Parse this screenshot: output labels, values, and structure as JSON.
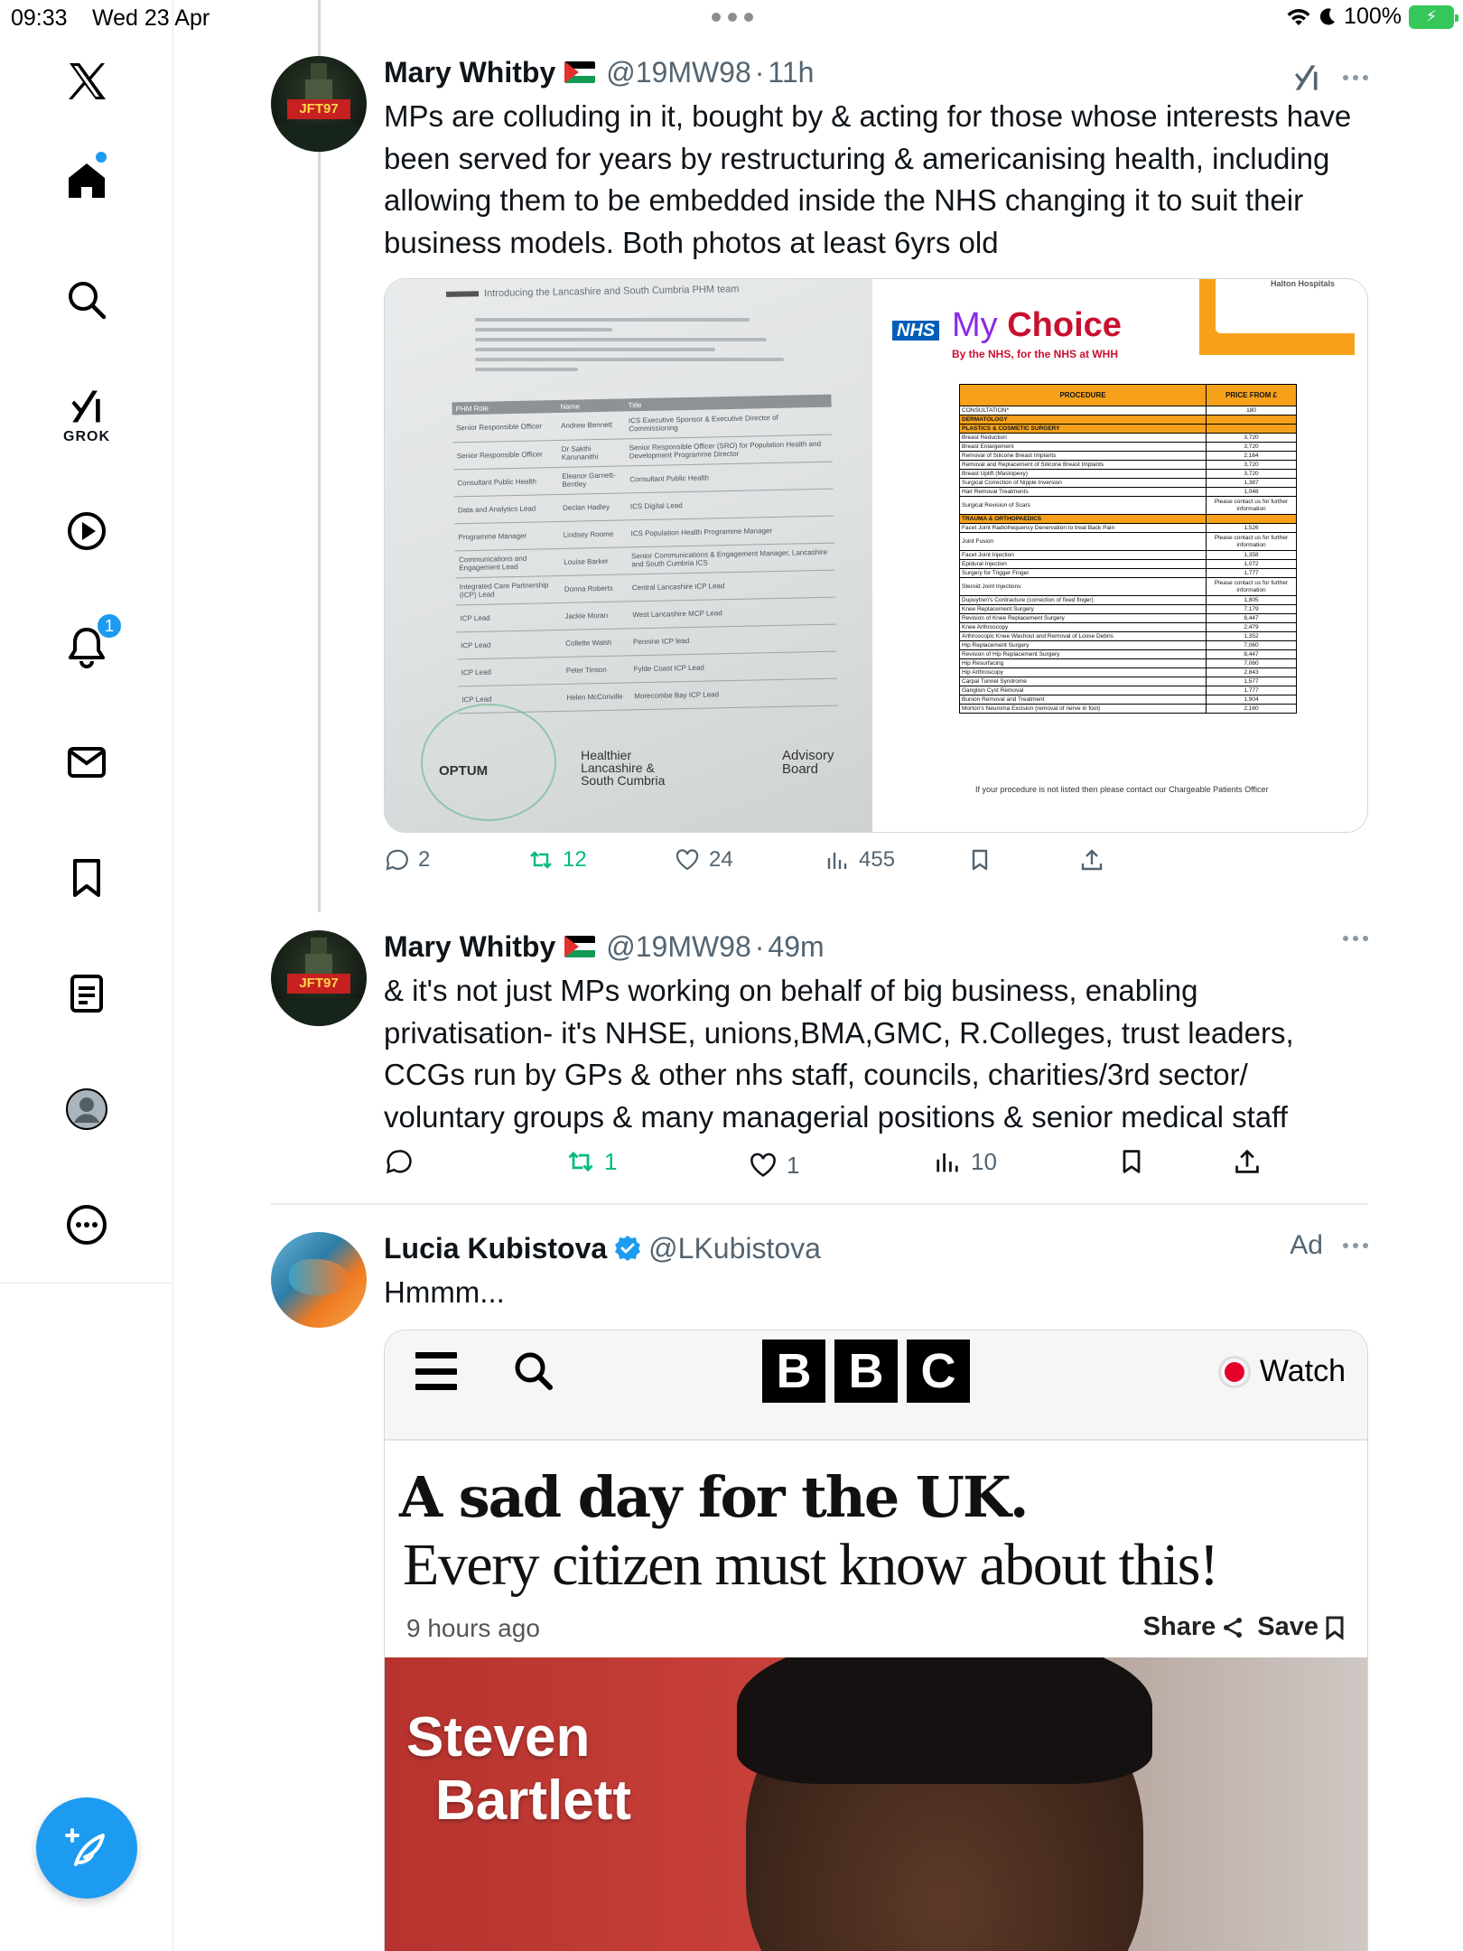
{
  "status_bar": {
    "time": "09:33",
    "date": "Wed 23 Apr",
    "battery": "100%"
  },
  "sidebar": {
    "items": [
      {
        "name": "x-logo"
      },
      {
        "name": "home"
      },
      {
        "name": "search"
      },
      {
        "name": "grok",
        "label": "GROK"
      },
      {
        "name": "video"
      },
      {
        "name": "notifications",
        "badge": "1"
      },
      {
        "name": "messages"
      },
      {
        "name": "bookmarks"
      },
      {
        "name": "lists"
      },
      {
        "name": "profile"
      },
      {
        "name": "more"
      }
    ]
  },
  "tweets": [
    {
      "name": "Mary Whitby",
      "handle": "@19MW98",
      "sep": "·",
      "time": "11h",
      "text": "MPs are colluding in it, bought by & acting for those whose interests have been served for years by restructuring & americanising health, including allowing them to be embedded inside the NHS changing it to suit their business models. Both photos at least 6yrs old",
      "avatar_banner": "JFT97",
      "actions": {
        "replies": "2",
        "reposts": "12",
        "likes": "24",
        "views": "455"
      }
    },
    {
      "name": "Mary Whitby",
      "handle": "@19MW98",
      "sep": "·",
      "time": "49m",
      "text": "& it's not just MPs working on behalf of big business, enabling privatisation- it's NHSE, unions,BMA,GMC, R.Colleges, trust leaders, CCGs run by GPs & other nhs staff, councils, charities/3rd sector/ voluntary groups & many managerial positions & senior medical staff",
      "avatar_banner": "JFT97",
      "actions": {
        "replies": "",
        "reposts": "1",
        "likes": "1",
        "views": "10"
      }
    },
    {
      "name": "Lucia Kubistova",
      "handle": "@LKubistova",
      "ad_label": "Ad",
      "text": "Hmmm..."
    }
  ],
  "media1": {
    "doc": {
      "title": "Introducing the Lancashire and South Cumbria PHM team",
      "headers": [
        "PHM Role",
        "Name",
        "Title"
      ],
      "rows": [
        [
          "Senior Responsible Officer",
          "Andrew Bennett",
          "ICS Executive Sponsor & Executive Director of Commissioning"
        ],
        [
          "Senior Responsible Officer",
          "Dr Sakthi Karunanithi",
          "Senior Responsible Officer (SRO) for Population Health and Development Programme Director"
        ],
        [
          "Consultant Public Health",
          "Eleanor Garnett-Bentley",
          "Consultant Public Health"
        ],
        [
          "Data and Analytics Lead",
          "Declan Hadley",
          "ICS Digital Lead"
        ],
        [
          "Programme Manager",
          "Lindsey Roome",
          "ICS Population Health Programme Manager"
        ],
        [
          "Communications and Engagement Lead",
          "Louise Barker",
          "Senior Communications & Engagement Manager, Lancashire and South Cumbria ICS"
        ],
        [
          "Integrated Care Partnership (ICP) Lead",
          "Donna Roberts",
          "Central Lancashire ICP Lead"
        ],
        [
          "ICP Lead",
          "Jackie Moran",
          "West Lancashire MCP Lead"
        ],
        [
          "ICP Lead",
          "Collette Walsh",
          "Pennine ICP lead"
        ],
        [
          "ICP Lead",
          "Peter Tinson",
          "Fylde Coast ICP Lead"
        ],
        [
          "ICP Lead",
          "Helen McConville",
          "Morecombe Bay ICP Lead"
        ]
      ],
      "logos": [
        "OPTUM",
        "Healthier Lancashire & South Cumbria",
        "Advisory Board"
      ]
    },
    "choice": {
      "hospital": "Halton Hospitals",
      "nhs": "NHS",
      "brand_my": "My",
      "brand_choice": "Choice",
      "tagline": "By the NHS, for the NHS at WHH",
      "headers": [
        "PROCEDURE",
        "PRICE FROM £"
      ],
      "rows": [
        {
          "p": "CONSULTATION*",
          "v": "180"
        },
        {
          "p": "DERMATOLOGY",
          "v": "",
          "cat": true
        },
        {
          "p": "PLASTICS & COSMETIC SURGERY",
          "v": "",
          "cat": true
        },
        {
          "p": "Breast Reduction",
          "v": "3,720"
        },
        {
          "p": "Breast Enlargement",
          "v": "3,720"
        },
        {
          "p": "Removal of Silicone Breast Implants",
          "v": "2,164"
        },
        {
          "p": "Removal and Replacement of Silicone Breast Implants",
          "v": "3,720"
        },
        {
          "p": "Breast Uplift (Mastopexy)",
          "v": "3,720"
        },
        {
          "p": "Surgical Correction of Nipple Inversion",
          "v": "1,387"
        },
        {
          "p": "Hair Removal Treatments",
          "v": "1,048"
        },
        {
          "p": "Surgical Revision of Scars",
          "v": "Please contact us for further information",
          "tall": true
        },
        {
          "p": "TRAUMA & ORTHOPAEDICS",
          "v": "",
          "cat": true
        },
        {
          "p": "Facet Joint Radiofrequency Denervation to treat Back Pain",
          "v": "1,526"
        },
        {
          "p": "Joint Fusion",
          "v": "Please contact us for further information",
          "tall": true
        },
        {
          "p": "Facet Joint Injection",
          "v": "1,358"
        },
        {
          "p": "Epidural Injection",
          "v": "1,072"
        },
        {
          "p": "Surgery for Trigger Finger",
          "v": "1,777"
        },
        {
          "p": "Steroid Joint Injections",
          "v": "Please contact us for further information",
          "tall": true
        },
        {
          "p": "Dupuytren's Contracture (correction of fixed finger)",
          "v": "1,805"
        },
        {
          "p": "Knee Replacement Surgery",
          "v": "7,179"
        },
        {
          "p": "Revision of Knee Replacement Surgery",
          "v": "8,447"
        },
        {
          "p": "Knee Arthroscopy",
          "v": "2,479"
        },
        {
          "p": "Arthroscopic Knee Washout and Removal of Loose Debris",
          "v": "1,352"
        },
        {
          "p": "Hip Replacement Surgery",
          "v": "7,060"
        },
        {
          "p": "Revision of Hip Replacement Surgery",
          "v": "8,447"
        },
        {
          "p": "Hip Resurfacing",
          "v": "7,060"
        },
        {
          "p": "Hip Arthroscopy",
          "v": "2,843"
        },
        {
          "p": "Carpal Tunnel Syndrome",
          "v": "1,577"
        },
        {
          "p": "Ganglion Cyst Removal",
          "v": "1,777"
        },
        {
          "p": "Bunion Removal and Treatment",
          "v": "1,904"
        },
        {
          "p": "Morton's Neuroma Excision (removal of nerve in foot)",
          "v": "2,160"
        }
      ],
      "footnote": "If your procedure is not listed then please contact our Chargeable Patients Officer"
    }
  },
  "media2": {
    "logo_letters": [
      "B",
      "B",
      "C"
    ],
    "watch_label": "Watch",
    "headline": "A sad day for the UK.",
    "subheadline": "Every citizen must know about this!",
    "meta": "9 hours ago",
    "share_label": "Share",
    "save_label": "Save",
    "photo_name_line1": "Steven",
    "photo_name_line2": "Bartlett"
  }
}
